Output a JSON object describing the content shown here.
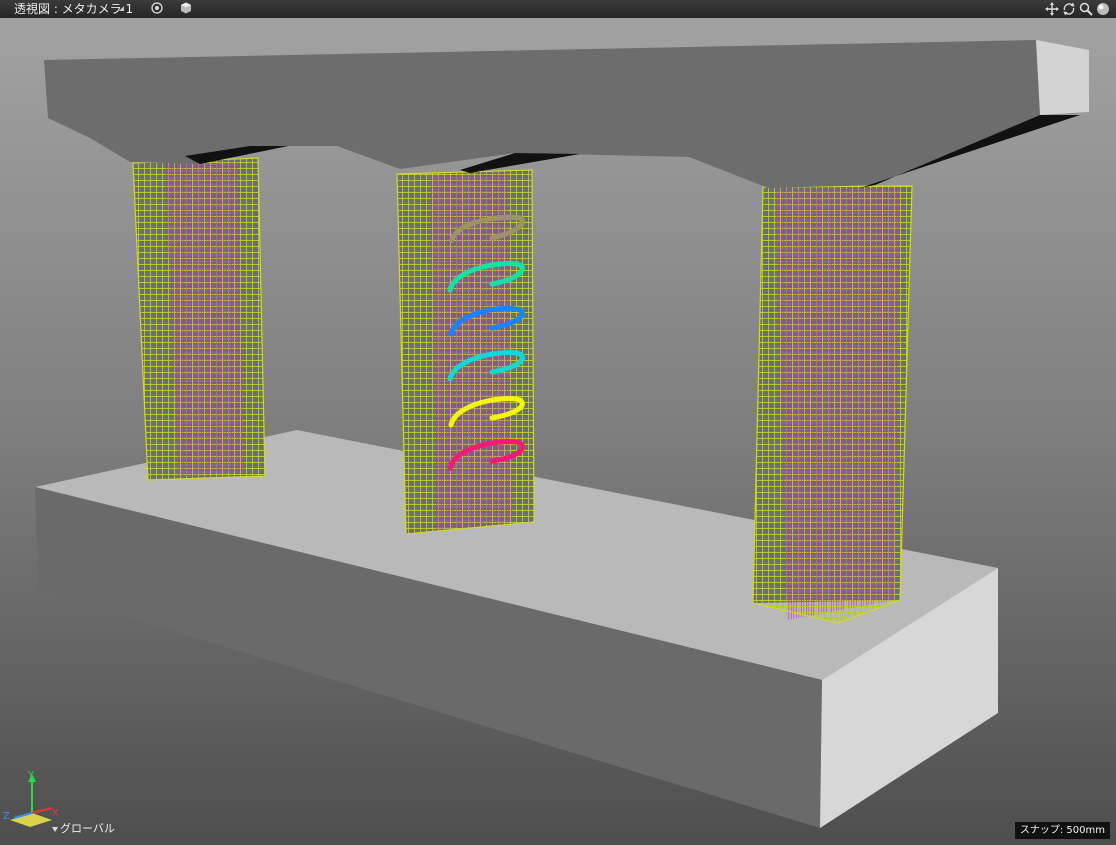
{
  "viewbar": {
    "title": "透視図 : メタカメラ 1",
    "icons": [
      "display-mode-icon",
      "shading-icon",
      "pan-icon",
      "orbit-icon",
      "zoom-icon",
      "sphere-icon"
    ]
  },
  "axis": {
    "y": "Y",
    "x": "X",
    "z": "Z",
    "coordinate_system": "グローバル"
  },
  "status": {
    "snap": "スナップ: 500mm"
  },
  "colors": {
    "stirrups": [
      "#9c936a",
      "#17e2a6",
      "#1a84ff",
      "#13d7d8",
      "#f4f413",
      "#f21a78"
    ],
    "rebar_grid": "#c5c82c",
    "rebar_inner": "#cc22cc"
  }
}
